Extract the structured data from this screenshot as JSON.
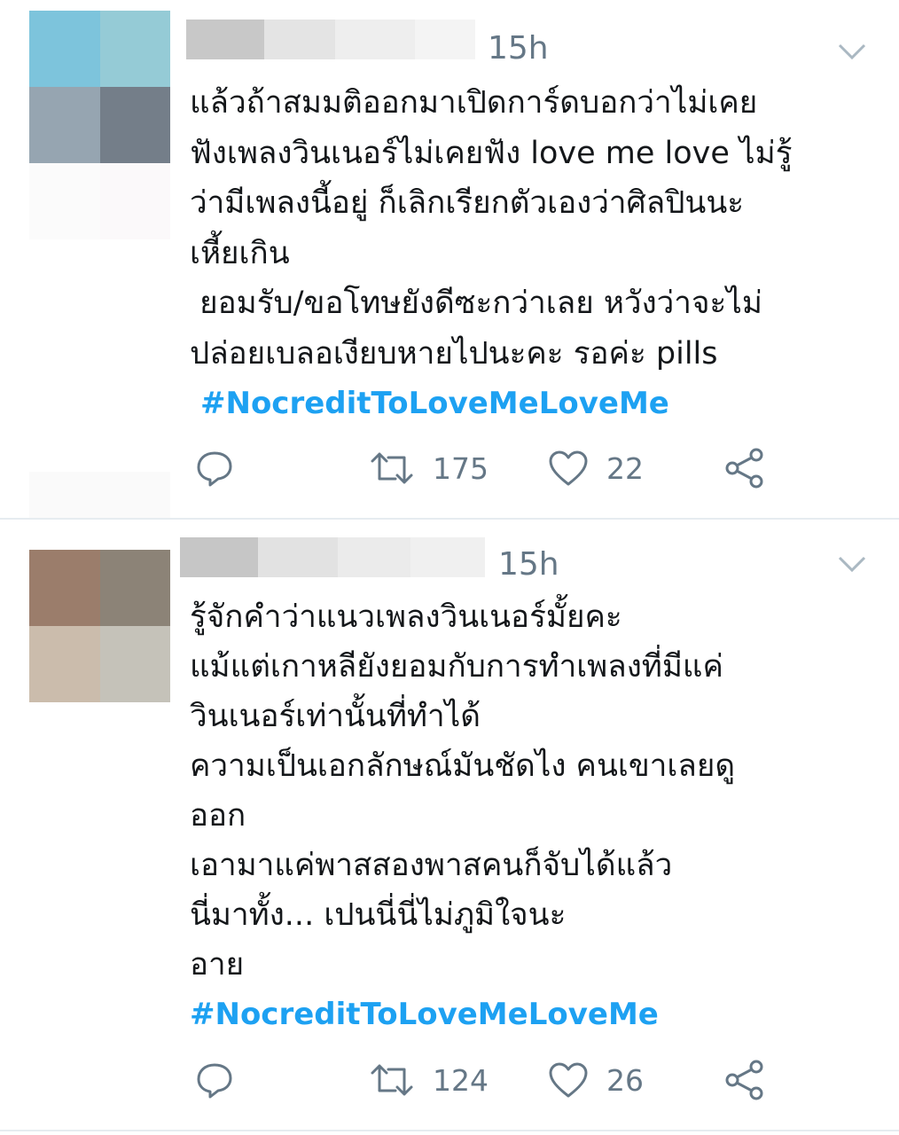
{
  "tweets": [
    {
      "avatar_colors": [
        "#7dc4dc",
        "#95cbd6",
        "#96a5b1",
        "#747e89",
        "#fbfbfb",
        "#fbf9fa"
      ],
      "time": "15h",
      "lines": [
        "แล้วถ้าสมมติออกมาเปิดการ์ดบอกว่าไม่เคย",
        "ฟังเพลงวินเนอร์ไม่เคยฟัง love me love ไม่รู้",
        "ว่ามีเพลงนี้อยู่ ก็เลิกเรียกตัวเองว่าศิลปินนะ",
        "เหี้ยเกิน",
        " ยอมรับ/ขอโทษยังดีซะกว่าเลย หวังว่าจะไม่",
        "ปล่อยเบลอเงียบหายไปนะคะ รอค่ะ pills"
      ],
      "hashtag": "#NocreditToLoveMeLoveMe",
      "retweets": "175",
      "likes": "22"
    },
    {
      "avatar_colors": [
        "#9b7d6b",
        "#8c8377",
        "#cbbcac",
        "#c5c2b9"
      ],
      "time": "15h",
      "lines": [
        "รู้จักคำว่าแนวเพลงวินเนอร์มั้ยคะ",
        "แม้แต่เกาหลียังยอมกับการทำเพลงที่มีแค่",
        "วินเนอร์เท่านั้นที่ทำได้",
        "ความเป็นเอกลักษณ์มันชัดไง คนเขาเลยดู",
        "ออก",
        "เอามาแค่พาสสองพาสคนก็จับได้แล้ว",
        "นี่มาทั้ง... เปนนี่นี่ไม่ภูมิใจนะ",
        "อาย"
      ],
      "hashtag": "#NocreditToLoveMeLoveMe",
      "retweets": "124",
      "likes": "26"
    }
  ],
  "colors": {
    "hashtag": "#1da1f2",
    "meta": "#657786",
    "divider": "#e6ecf0"
  },
  "icons": [
    "reply-icon",
    "retweet-icon",
    "like-icon",
    "share-icon",
    "chevron-down-icon"
  ]
}
